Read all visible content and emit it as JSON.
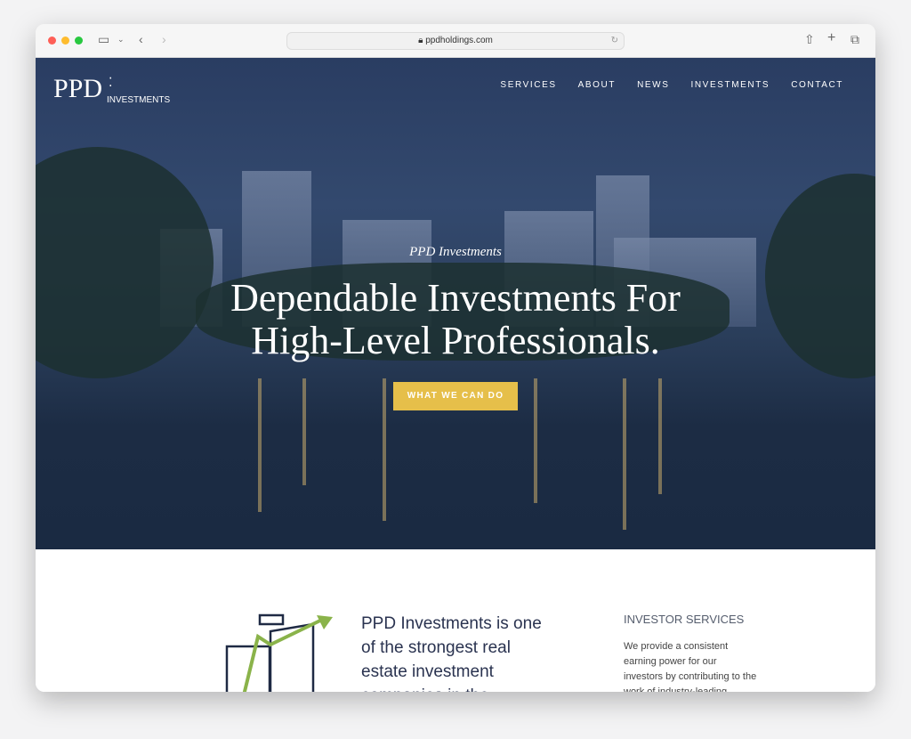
{
  "browser": {
    "url": "ppdholdings.com"
  },
  "logo": {
    "main": "PPD",
    "sub": "INVESTMENTS"
  },
  "nav": [
    "SERVICES",
    "ABOUT",
    "NEWS",
    "INVESTMENTS",
    "CONTACT"
  ],
  "hero": {
    "subtitle": "PPD Investments",
    "headline": "Dependable Investments For High-Level Professionals.",
    "cta": "WHAT WE CAN DO"
  },
  "intro": {
    "text": "PPD Investments is one of the strongest real estate investment companies in the"
  },
  "services": {
    "heading": "INVESTOR SERVICES",
    "text": "We provide a consistent earning power for our investors by contributing to the work of industry-leading"
  },
  "colors": {
    "accent": "#e6bf4a",
    "navy": "#2a3d62",
    "green": "#8ab34a"
  }
}
